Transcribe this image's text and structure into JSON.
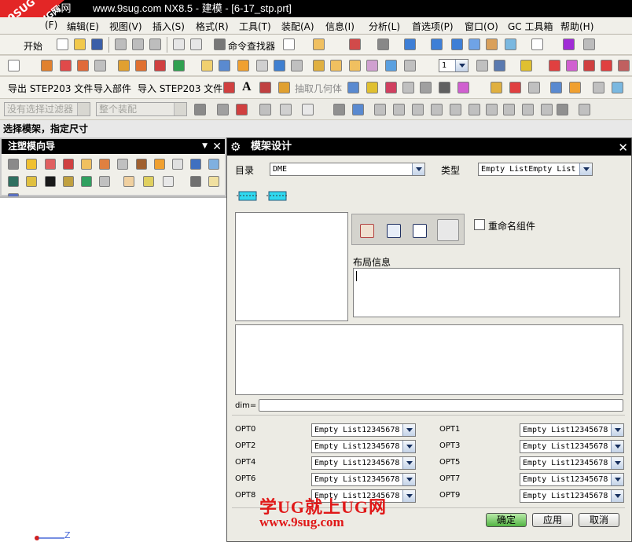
{
  "title_bar": {
    "prefix": "UG网",
    "text": "www.9sug.com NX8.5 - 建模 - [6-17_stp.prt]"
  },
  "badge": {
    "line1": "9SUG",
    "line2": "学UG就上UG网"
  },
  "menu": [
    {
      "label": "(F)"
    },
    {
      "label": "编辑(E)"
    },
    {
      "label": "视图(V)"
    },
    {
      "label": "插入(S)"
    },
    {
      "label": "格式(R)"
    },
    {
      "label": "工具(T)"
    },
    {
      "label": "装配(A)"
    },
    {
      "label": "信息(I)"
    },
    {
      "label": "分析(L)"
    },
    {
      "label": "首选项(P)"
    },
    {
      "label": "窗口(O)"
    },
    {
      "label": "GC 工具箱"
    },
    {
      "label": "帮助(H)"
    }
  ],
  "toolbar1": {
    "start_label": "开始",
    "find_command_label": "命令查找器"
  },
  "toolbar2": {
    "layer_value": "1"
  },
  "toolbar3": {
    "items": [
      "导出 STEP203 文件",
      "导入部件",
      "导入 STEP203 文件"
    ],
    "extract_geometry_label": "抽取几何体"
  },
  "toolbar4": {
    "filter_placeholder": "没有选择过滤器",
    "assembly_placeholder": "整个装配"
  },
  "status": "选择模架，指定尺寸",
  "navigator": {
    "title": "注塑模向导"
  },
  "axis_label": "Z",
  "dialog": {
    "title": "模架设计",
    "catalog_label": "目录",
    "catalog_value": "DME",
    "type_label": "类型",
    "type_value": "Empty ListEmpty List",
    "rename_label": "重命名组件",
    "layout_label": "布局信息",
    "dim_label": "dim=",
    "options": [
      {
        "label": "OPT0",
        "value": "Empty List12345678"
      },
      {
        "label": "OPT1",
        "value": "Empty List12345678"
      },
      {
        "label": "OPT2",
        "value": "Empty List12345678"
      },
      {
        "label": "OPT3",
        "value": "Empty List12345678"
      },
      {
        "label": "OPT4",
        "value": "Empty List12345678"
      },
      {
        "label": "OPT5",
        "value": "Empty List12345678"
      },
      {
        "label": "OPT6",
        "value": "Empty List12345678"
      },
      {
        "label": "OPT7",
        "value": "Empty List12345678"
      },
      {
        "label": "OPT8",
        "value": "Empty List12345678"
      },
      {
        "label": "OPT9",
        "value": "Empty List12345678"
      }
    ],
    "ok_label": "确定",
    "apply_label": "应用",
    "cancel_label": "取消"
  },
  "watermark": {
    "line1": "学UG就上UG网",
    "line2": "www.9sug.com"
  }
}
